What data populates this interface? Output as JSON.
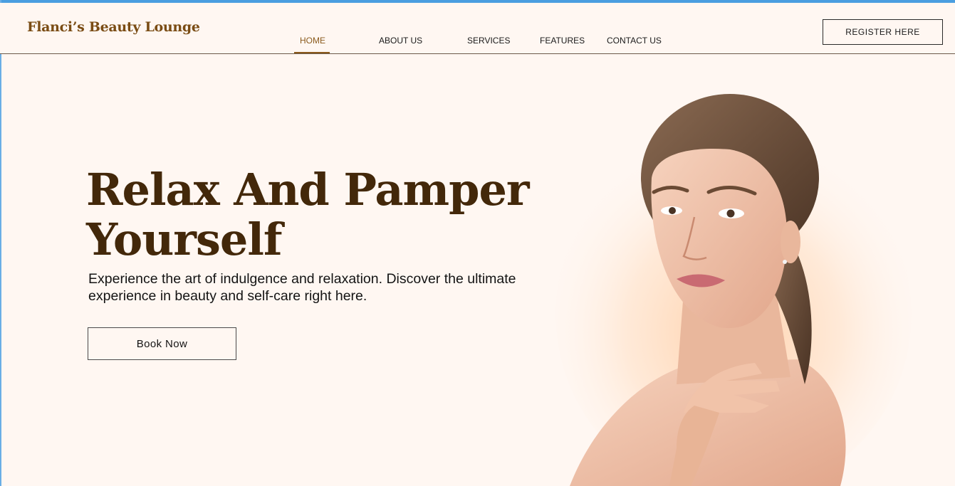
{
  "header": {
    "brand": "Flanci’s Beauty Lounge",
    "nav": [
      {
        "label": "HOME"
      },
      {
        "label": "ABOUT US"
      },
      {
        "label": "SERVICES"
      },
      {
        "label": "FEATURES"
      },
      {
        "label": "CONTACT US"
      }
    ],
    "active_nav": "HOME",
    "register_label": "REGISTER HERE"
  },
  "hero": {
    "title": "Relax And Pamper Yourself",
    "subtitle": "Experience the art of indulgence and relaxation. Discover the ultimate experience in beauty and self-care right here.",
    "cta_label": "Book Now",
    "image_icon": "woman-portrait-photo"
  },
  "colors": {
    "background": "#fff7f2",
    "brand": "#7a4c14",
    "title": "#43280a",
    "active_nav": "#8a5a1c",
    "window_frame": "#4a9ee0"
  }
}
